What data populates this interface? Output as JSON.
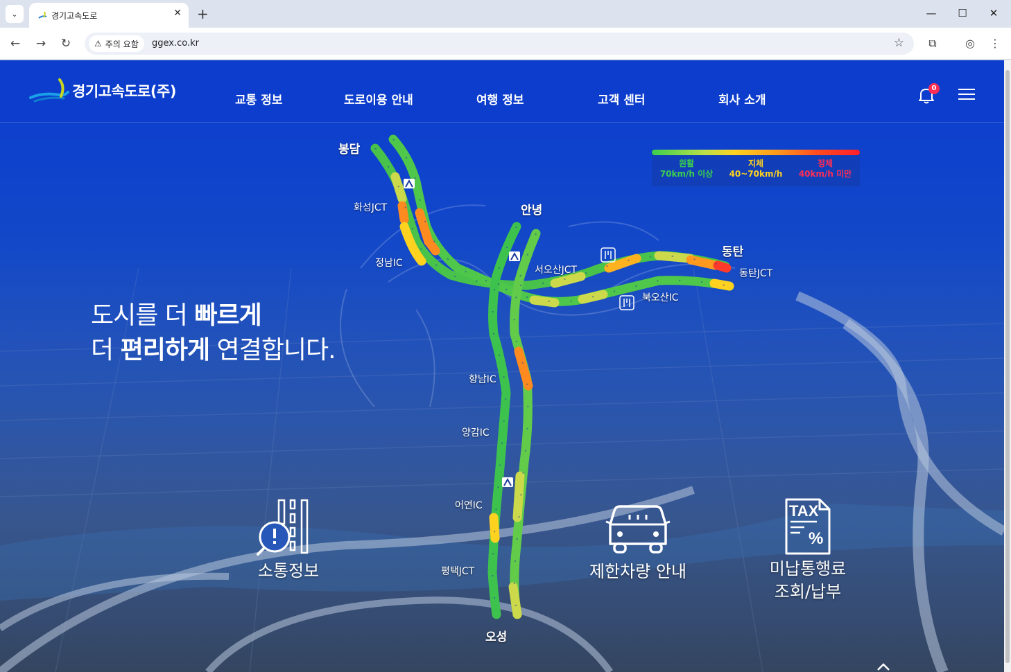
{
  "browser": {
    "tab_title": "경기고속도로",
    "tab_close": "✕",
    "new_tab": "+",
    "security_chip": "주의 요함",
    "url": "ggex.co.kr"
  },
  "site": {
    "logo_text": "경기고속도로(주)",
    "nav": [
      "교통 정보",
      "도로이용 안내",
      "여행 정보",
      "고객 센터",
      "회사 소개"
    ],
    "notification_count": "0"
  },
  "hero": {
    "line1_light": "도시를 더 ",
    "line1_bold": "빠르게",
    "line2_light_a": "더 ",
    "line2_bold": "편리하게",
    "line2_light_b": " 연결합니다."
  },
  "legend": {
    "smooth_title": "원활",
    "smooth_range": "70km/h 이상",
    "slow_title": "지체",
    "slow_range": "40~70km/h",
    "jam_title": "정체",
    "jam_range": "40km/h 미만",
    "colors": {
      "smooth": "#3ccf4e",
      "slow": "#ffd21f",
      "jam": "#ff2d2d"
    }
  },
  "map_labels": {
    "bongdam": "봉담",
    "anyeong": "안녕",
    "dongtan": "동탄",
    "oseong": "오성",
    "hwaseong_jct": "화성JCT",
    "jeongnam_ic": "정남IC",
    "seosan_jct": "서오산JCT",
    "dongtan_jct": "동탄JCT",
    "bukosan_ic": "북오산IC",
    "hyangnam_ic": "향남IC",
    "yanggam_ic": "양감IC",
    "eoyeon_ic": "어연IC",
    "pyeongtaek_jct": "평택JCT"
  },
  "quick_links": {
    "traffic": "소통정보",
    "restricted_vehicle": "제한차량 안내",
    "unpaid_toll_line1": "미납통행료",
    "unpaid_toll_line2": "조회/납부",
    "tax_text": "TAX"
  },
  "icons": {
    "tab_search": "chevron-down-icon",
    "back": "back-arrow-icon",
    "forward": "forward-arrow-icon",
    "reload": "reload-icon",
    "bookmark": "star-icon",
    "extensions": "puzzle-icon",
    "profile": "profile-icon",
    "more": "kebab-icon",
    "bell": "bell-icon",
    "menu": "hamburger-icon"
  }
}
